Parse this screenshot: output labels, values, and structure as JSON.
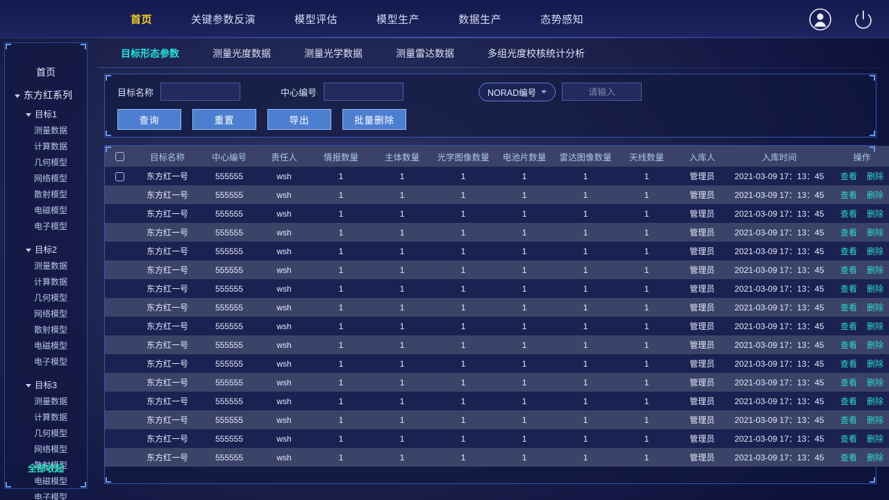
{
  "topnav": {
    "items": [
      {
        "label": "首页",
        "active": true
      },
      {
        "label": "关键参数反演",
        "active": false
      },
      {
        "label": "模型评估",
        "active": false
      },
      {
        "label": "模型生产",
        "active": false
      },
      {
        "label": "数据生产",
        "active": false
      },
      {
        "label": "态势感知",
        "active": false
      }
    ],
    "icons": {
      "user": "user-avatar-icon",
      "power": "power-icon"
    },
    "active_color": "#f5d021"
  },
  "sidebar": {
    "home": "首页",
    "series": "东方红系列",
    "collapse_all": "全部收起",
    "groups": [
      {
        "label": "目标1",
        "children": [
          "测量数据",
          "计算数据",
          "几何模型",
          "网络模型",
          "散射模型",
          "电磁模型",
          "电子模型"
        ]
      },
      {
        "label": "目标2",
        "children": [
          "测量数据",
          "计算数据",
          "几何模型",
          "网络模型",
          "散射模型",
          "电磁模型",
          "电子模型"
        ]
      },
      {
        "label": "目标3",
        "children": [
          "测量数据",
          "计算数据",
          "几何模型",
          "网络模型",
          "散射模型",
          "电磁模型",
          "电子模型"
        ]
      }
    ]
  },
  "subtabs": {
    "active_color": "#28e0e0",
    "items": [
      {
        "label": "目标形态参数",
        "active": true
      },
      {
        "label": "测量光度数据",
        "active": false
      },
      {
        "label": "测量光学数据",
        "active": false
      },
      {
        "label": "测量雷达数据",
        "active": false
      },
      {
        "label": "多组光度校核统计分析",
        "active": false
      }
    ]
  },
  "filter": {
    "target_name_label": "目标名称",
    "target_name_value": "",
    "target_name_placeholder": "",
    "center_no_label": "中心编号",
    "center_no_value": "",
    "center_no_placeholder": "",
    "norad_select_value": "NORAD编号",
    "norad_input_value": "",
    "norad_input_placeholder": "请输入",
    "buttons": [
      {
        "label": "查询",
        "name": "query-button"
      },
      {
        "label": "重置",
        "name": "reset-button"
      },
      {
        "label": "导出",
        "name": "export-button"
      },
      {
        "label": "批量删除",
        "name": "batch-delete-button"
      }
    ]
  },
  "table": {
    "headers": [
      "目标名称",
      "中心编号",
      "责任人",
      "情报数量",
      "主体数量",
      "光学图像数量",
      "电池片数量",
      "雷达图像数量",
      "天线数量",
      "入库人",
      "入库时间",
      "操作"
    ],
    "actions": {
      "view": "查看",
      "delete": "删除"
    },
    "rows": [
      {
        "checkbox": true,
        "name": "东方红一号",
        "center": "555555",
        "resp": "wsh",
        "intel": "1",
        "body": "1",
        "optical": "1",
        "battery": "1",
        "radar": "1",
        "antenna": "1",
        "user": "管理员",
        "time": "2021-03-09 17：13：45"
      },
      {
        "checkbox": false,
        "name": "东方红一号",
        "center": "555555",
        "resp": "wsh",
        "intel": "1",
        "body": "1",
        "optical": "1",
        "battery": "1",
        "radar": "1",
        "antenna": "1",
        "user": "管理员",
        "time": "2021-03-09 17：13：45"
      },
      {
        "checkbox": false,
        "name": "东方红一号",
        "center": "555555",
        "resp": "wsh",
        "intel": "1",
        "body": "1",
        "optical": "1",
        "battery": "1",
        "radar": "1",
        "antenna": "1",
        "user": "管理员",
        "time": "2021-03-09 17：13：45"
      },
      {
        "checkbox": false,
        "name": "东方红一号",
        "center": "555555",
        "resp": "wsh",
        "intel": "1",
        "body": "1",
        "optical": "1",
        "battery": "1",
        "radar": "1",
        "antenna": "1",
        "user": "管理员",
        "time": "2021-03-09 17：13：45"
      },
      {
        "checkbox": false,
        "name": "东方红一号",
        "center": "555555",
        "resp": "wsh",
        "intel": "1",
        "body": "1",
        "optical": "1",
        "battery": "1",
        "radar": "1",
        "antenna": "1",
        "user": "管理员",
        "time": "2021-03-09 17：13：45"
      },
      {
        "checkbox": false,
        "name": "东方红一号",
        "center": "555555",
        "resp": "wsh",
        "intel": "1",
        "body": "1",
        "optical": "1",
        "battery": "1",
        "radar": "1",
        "antenna": "1",
        "user": "管理员",
        "time": "2021-03-09 17：13：45"
      },
      {
        "checkbox": false,
        "name": "东方红一号",
        "center": "555555",
        "resp": "wsh",
        "intel": "1",
        "body": "1",
        "optical": "1",
        "battery": "1",
        "radar": "1",
        "antenna": "1",
        "user": "管理员",
        "time": "2021-03-09 17：13：45"
      },
      {
        "checkbox": false,
        "name": "东方红一号",
        "center": "555555",
        "resp": "wsh",
        "intel": "1",
        "body": "1",
        "optical": "1",
        "battery": "1",
        "radar": "1",
        "antenna": "1",
        "user": "管理员",
        "time": "2021-03-09 17：13：45"
      },
      {
        "checkbox": false,
        "name": "东方红一号",
        "center": "555555",
        "resp": "wsh",
        "intel": "1",
        "body": "1",
        "optical": "1",
        "battery": "1",
        "radar": "1",
        "antenna": "1",
        "user": "管理员",
        "time": "2021-03-09 17：13：45"
      },
      {
        "checkbox": false,
        "name": "东方红一号",
        "center": "555555",
        "resp": "wsh",
        "intel": "1",
        "body": "1",
        "optical": "1",
        "battery": "1",
        "radar": "1",
        "antenna": "1",
        "user": "管理员",
        "time": "2021-03-09 17：13：45"
      },
      {
        "checkbox": false,
        "name": "东方红一号",
        "center": "555555",
        "resp": "wsh",
        "intel": "1",
        "body": "1",
        "optical": "1",
        "battery": "1",
        "radar": "1",
        "antenna": "1",
        "user": "管理员",
        "time": "2021-03-09 17：13：45"
      },
      {
        "checkbox": false,
        "name": "东方红一号",
        "center": "555555",
        "resp": "wsh",
        "intel": "1",
        "body": "1",
        "optical": "1",
        "battery": "1",
        "radar": "1",
        "antenna": "1",
        "user": "管理员",
        "time": "2021-03-09 17：13：45"
      },
      {
        "checkbox": false,
        "name": "东方红一号",
        "center": "555555",
        "resp": "wsh",
        "intel": "1",
        "body": "1",
        "optical": "1",
        "battery": "1",
        "radar": "1",
        "antenna": "1",
        "user": "管理员",
        "time": "2021-03-09 17：13：45"
      },
      {
        "checkbox": false,
        "name": "东方红一号",
        "center": "555555",
        "resp": "wsh",
        "intel": "1",
        "body": "1",
        "optical": "1",
        "battery": "1",
        "radar": "1",
        "antenna": "1",
        "user": "管理员",
        "time": "2021-03-09 17：13：45"
      },
      {
        "checkbox": false,
        "name": "东方红一号",
        "center": "555555",
        "resp": "wsh",
        "intel": "1",
        "body": "1",
        "optical": "1",
        "battery": "1",
        "radar": "1",
        "antenna": "1",
        "user": "管理员",
        "time": "2021-03-09 17：13：45"
      },
      {
        "checkbox": false,
        "name": "东方红一号",
        "center": "555555",
        "resp": "wsh",
        "intel": "1",
        "body": "1",
        "optical": "1",
        "battery": "1",
        "radar": "1",
        "antenna": "1",
        "user": "管理员",
        "time": "2021-03-09 17：13：45"
      }
    ]
  }
}
